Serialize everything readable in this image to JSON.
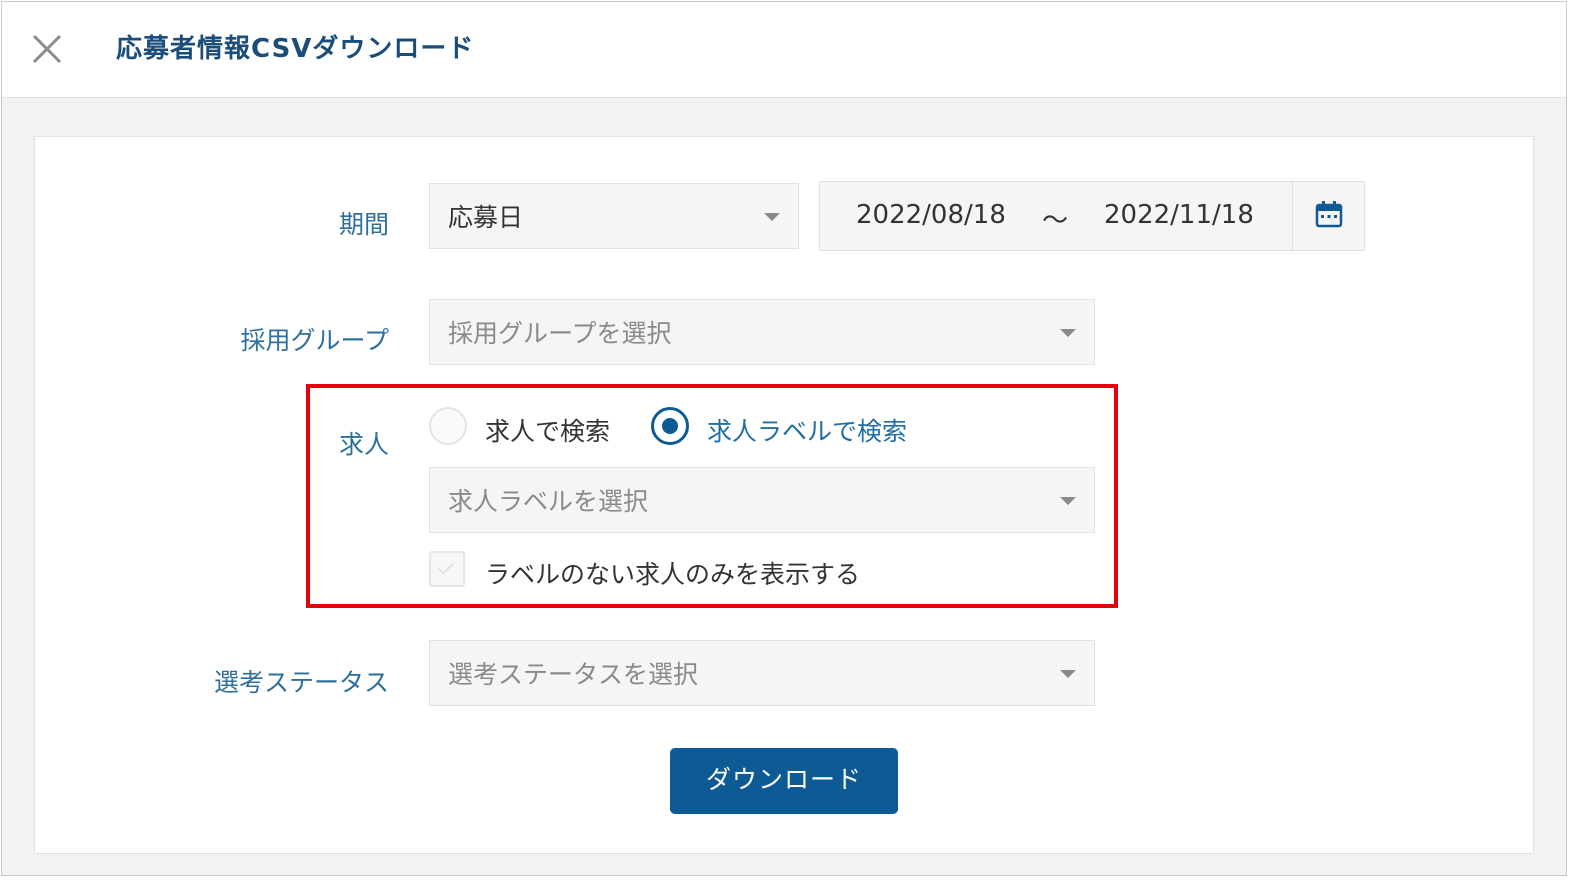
{
  "header": {
    "title": "応募者情報CSVダウンロード"
  },
  "period": {
    "label": "期間",
    "type_value": "応募日",
    "date_from": "2022/08/18",
    "separator": "〜",
    "date_to": "2022/11/18"
  },
  "group": {
    "label": "採用グループ",
    "placeholder": "採用グループを選択"
  },
  "job": {
    "label": "求人",
    "radio_options": [
      {
        "label": "求人で検索",
        "checked": false
      },
      {
        "label": "求人ラベルで検索",
        "checked": true
      }
    ],
    "label_select_placeholder": "求人ラベルを選択",
    "checkbox_label": "ラベルのない求人のみを表示する"
  },
  "status": {
    "label": "選考ステータス",
    "placeholder": "選考ステータスを選択"
  },
  "actions": {
    "download_label": "ダウンロード"
  },
  "colors": {
    "accent": "#0d5a95",
    "label_text": "#2f6f9c",
    "highlight_border": "#e8000b"
  }
}
